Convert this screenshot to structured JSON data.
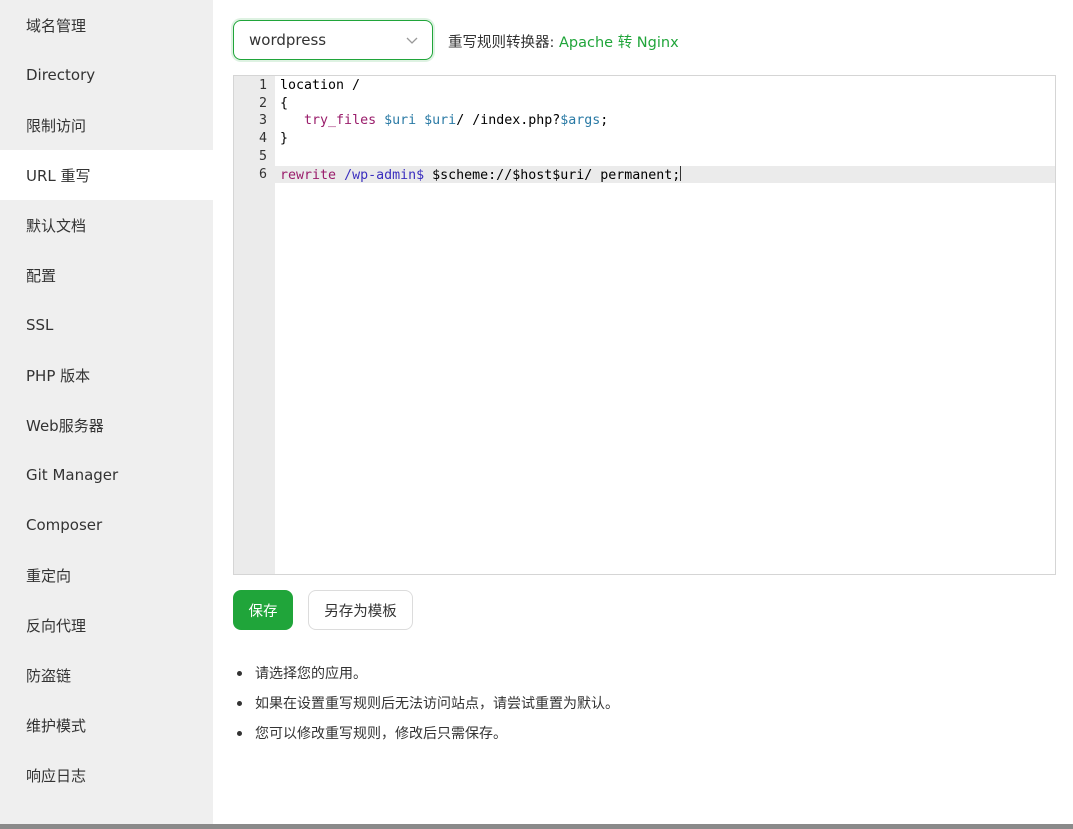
{
  "sidebar": {
    "items": [
      {
        "label": "域名管理"
      },
      {
        "label": "Directory"
      },
      {
        "label": "限制访问"
      },
      {
        "label": "URL 重写"
      },
      {
        "label": "默认文档"
      },
      {
        "label": "配置"
      },
      {
        "label": "SSL"
      },
      {
        "label": "PHP 版本"
      },
      {
        "label": "Web服务器"
      },
      {
        "label": "Git Manager"
      },
      {
        "label": "Composer"
      },
      {
        "label": "重定向"
      },
      {
        "label": "反向代理"
      },
      {
        "label": "防盗链"
      },
      {
        "label": "维护模式"
      },
      {
        "label": "响应日志"
      }
    ],
    "active_index": 3
  },
  "rewrite": {
    "selected_app": "wordpress",
    "converter_label": "重写规则转换器:",
    "converter_link": "Apache 转 Nginx"
  },
  "editor": {
    "line_numbers": [
      "1",
      "2",
      "3",
      "4",
      "5",
      "6"
    ],
    "lines": {
      "l1": "location /",
      "l2": "{",
      "l3_indent": "   ",
      "l3_kw": "try_files",
      "l3_v1": "$uri",
      "l3_v2": "$uri",
      "l3_mid": "/ /index.php?",
      "l3_v3": "$args",
      "l3_end": ";",
      "l4": "}",
      "l5": "",
      "l6_kw": "rewrite",
      "l6_regex": "/wp-admin$",
      "l6_rest": "$scheme://$host$uri/ permanent;"
    },
    "active_line": 6
  },
  "actions": {
    "save_label": "保存",
    "save_template_label": "另存为模板"
  },
  "tips": [
    "请选择您的应用。",
    "如果在设置重写规则后无法访问站点，请尝试重置为默认。",
    "您可以修改重写规则，修改后只需保存。"
  ],
  "colors": {
    "accent": "#20a53a",
    "sidebar_bg": "#efefef"
  }
}
